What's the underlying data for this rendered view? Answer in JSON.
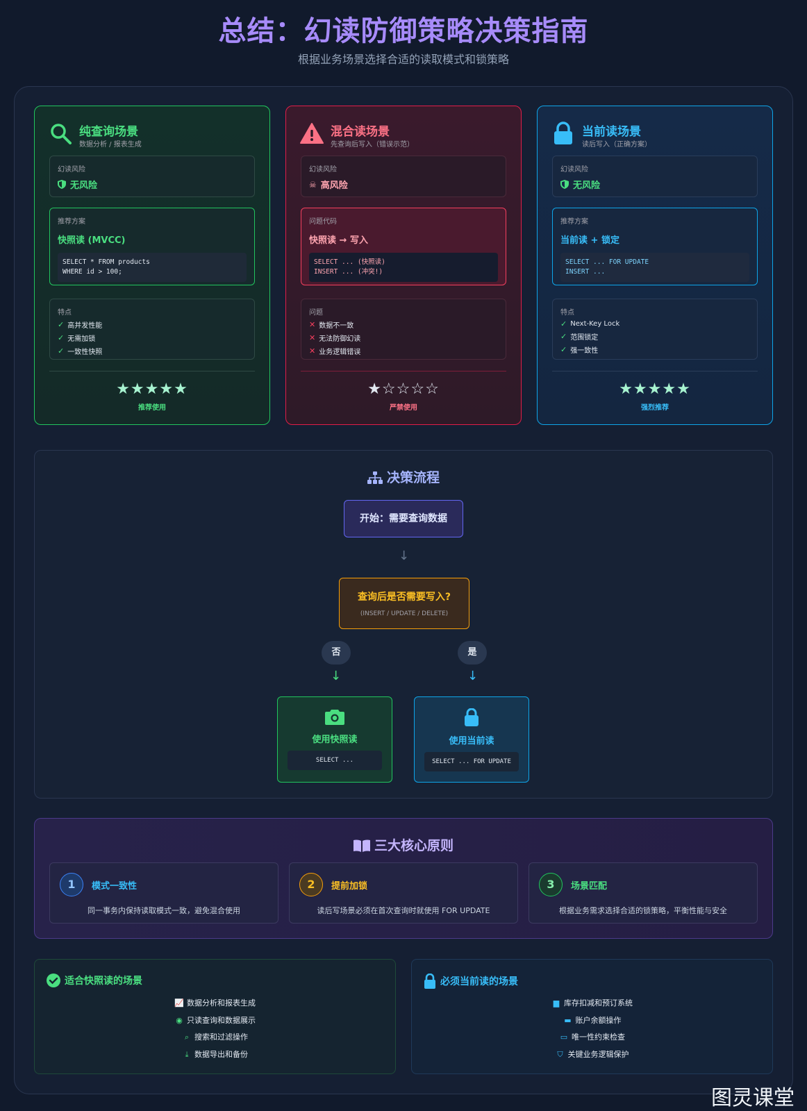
{
  "header": {
    "title": "总结：幻读防御策略决策指南",
    "subtitle": "根据业务场景选择合适的读取模式和锁策略"
  },
  "cards": [
    {
      "title": "纯查询场景",
      "subtitle": "数据分析 / 报表生成",
      "risk_label": "幻读风险",
      "risk_value": "无风险",
      "plan_label": "推荐方案",
      "plan_value": "快照读 (MVCC)",
      "code": [
        "SELECT * FROM products",
        "WHERE id > 100;"
      ],
      "feature_label": "特点",
      "features": [
        "高并发性能",
        "无需加锁",
        "一致性快照"
      ],
      "stars": "★★★★★",
      "rating": 5,
      "recommend": "推荐使用"
    },
    {
      "title": "混合读场景",
      "subtitle": "先查询后写入（错误示范）",
      "risk_label": "幻读风险",
      "risk_value": "高风险",
      "plan_label": "问题代码",
      "plan_value": "快照读 → 写入",
      "code": [
        "SELECT ... (快照读)",
        "INSERT ... (冲突!)"
      ],
      "feature_label": "问题",
      "features": [
        "数据不一致",
        "无法防御幻读",
        "业务逻辑错误"
      ],
      "stars": "★☆☆☆☆",
      "rating": 1,
      "recommend": "严禁使用"
    },
    {
      "title": "当前读场景",
      "subtitle": "读后写入（正确方案）",
      "risk_label": "幻读风险",
      "risk_value": "无风险",
      "plan_label": "推荐方案",
      "plan_value": "当前读 + 锁定",
      "code": [
        "SELECT ... FOR UPDATE",
        "INSERT ..."
      ],
      "feature_label": "特点",
      "features": [
        "Next-Key Lock",
        "范围锁定",
        "强一致性"
      ],
      "stars": "★★★★★",
      "rating": 5,
      "recommend": "强烈推荐"
    }
  ],
  "flow": {
    "title": "决策流程",
    "start": "开始：需要查询数据",
    "question": "查询后是否需要写入?",
    "question_sub": "(INSERT / UPDATE / DELETE)",
    "no": "否",
    "yes": "是",
    "no_result": "使用快照读",
    "no_code": "SELECT ...",
    "yes_result": "使用当前读",
    "yes_code": "SELECT ... FOR UPDATE"
  },
  "principles": {
    "title": "三大核心原则",
    "items": [
      {
        "num": "1",
        "name": "模式一致性",
        "desc": "同一事务内保持读取模式一致，避免混合使用"
      },
      {
        "num": "2",
        "name": "提前加锁",
        "desc": "读后写场景必须在首次查询时就使用 FOR UPDATE"
      },
      {
        "num": "3",
        "name": "场景匹配",
        "desc": "根据业务需求选择合适的锁策略，平衡性能与安全"
      }
    ]
  },
  "snapshot_scenes": {
    "title": "适合快照读的场景",
    "items": [
      "数据分析和报表生成",
      "只读查询和数据展示",
      "搜索和过滤操作",
      "数据导出和备份"
    ]
  },
  "current_scenes": {
    "title": "必须当前读的场景",
    "items": [
      "库存扣减和预订系统",
      "账户余额操作",
      "唯一性约束检查",
      "关键业务逻辑保护"
    ]
  },
  "watermark": "图灵课堂",
  "colors": {
    "accent": "#a78bfa",
    "success": "#4ade80",
    "danger": "#fb7185",
    "info": "#38bdf8",
    "warning": "#fbbf24"
  }
}
